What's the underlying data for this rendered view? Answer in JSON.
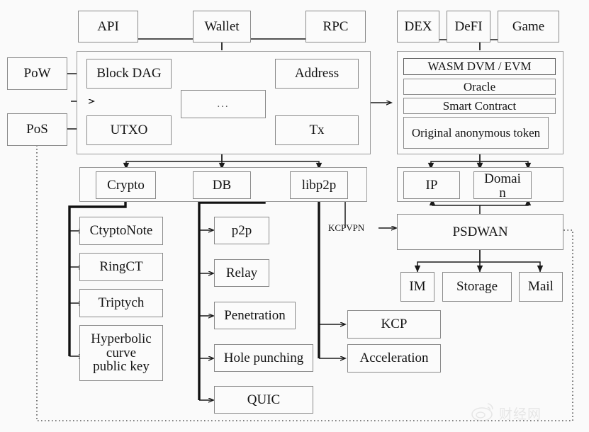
{
  "diagram": {
    "title": "Blockchain Platform Architecture",
    "colors": {
      "background": "#fafafa",
      "box_fill": "#fbfbfb",
      "box_border": "#8a8a8a",
      "line": "#1a1a1a",
      "line_thick": "#111111",
      "dotted": "#555555",
      "text": "#141414",
      "watermark": "#b9b9b9"
    },
    "consensus": {
      "pow": "PoW",
      "pos": "PoS"
    },
    "interfaces": {
      "api": "API",
      "wallet": "Wallet",
      "rpc": "RPC"
    },
    "dapps": {
      "dex": "DEX",
      "defi": "DeFI",
      "game": "Game"
    },
    "core_ledger": {
      "block_dag": "Block DAG",
      "ellipsis": "...",
      "address": "Address",
      "utxo": "UTXO",
      "tx": "Tx"
    },
    "vm_stack": {
      "wasm": "WASM DVM / EVM",
      "oracle": "Oracle",
      "smart_contract": "Smart Contract",
      "token": "Original anonymous token"
    },
    "infra": {
      "crypto": "Crypto",
      "db": "DB",
      "libp2p": "libp2p"
    },
    "naming": {
      "ip": "IP",
      "domain": "Domain",
      "domain_line1": "Domai",
      "domain_line2": "n"
    },
    "crypto_primitives": [
      "CtyptoNote",
      "RingCT",
      "Triptych",
      "Hyperbolic curve public key"
    ],
    "crypto_primitives_wrapped": {
      "hyperbolic_line1": "Hyperbolic",
      "hyperbolic_line2": "curve",
      "hyperbolic_line3": "public key"
    },
    "p2p_features": [
      "p2p",
      "Relay",
      "Penetration",
      "Hole punching",
      "QUIC"
    ],
    "transport": {
      "kcp": "KCP",
      "acceleration": "Acceleration",
      "kcpvpn_label": "KCPVPN"
    },
    "sdwan": {
      "psdwan": "PSDWAN",
      "im": "IM",
      "storage": "Storage",
      "mail": "Mail"
    },
    "watermark": {
      "text": "财经网"
    }
  }
}
